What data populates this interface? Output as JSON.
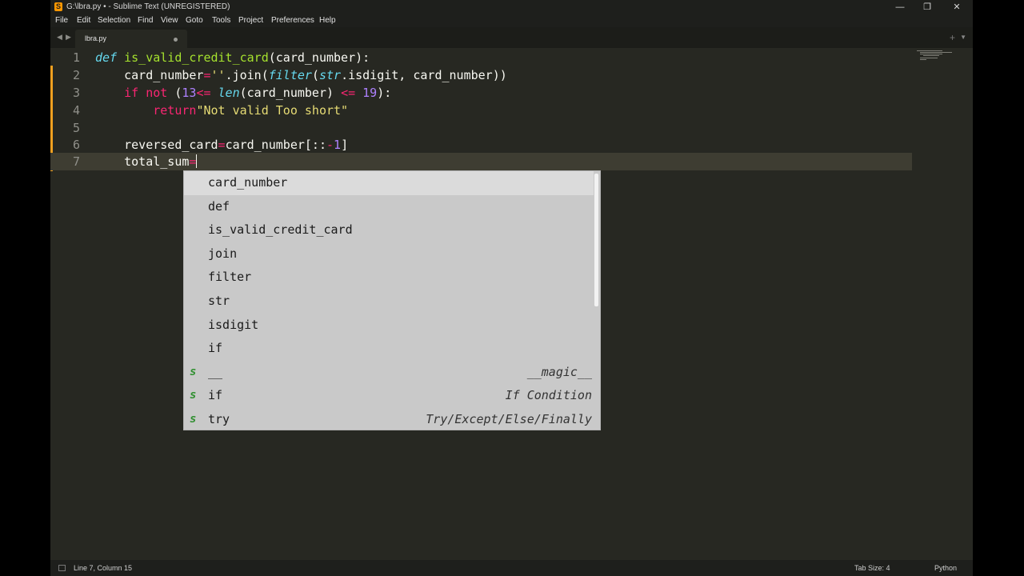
{
  "window": {
    "title": "G:\\lbra.py • - Sublime Text (UNREGISTERED)",
    "controls": [
      "—",
      "❐",
      "✕"
    ]
  },
  "menu": [
    "File",
    "Edit",
    "Selection",
    "Find",
    "View",
    "Goto",
    "Tools",
    "Project",
    "Preferences",
    "Help"
  ],
  "tabs": {
    "active": "lbra.py",
    "nav_prev": "◀",
    "nav_next": "▶",
    "new_tab": "+",
    "tab_menu": "▼"
  },
  "editor": {
    "line_numbers": [
      "1",
      "2",
      "3",
      "4",
      "5",
      "6",
      "7"
    ],
    "current_line": 7,
    "modified_lines": [
      2,
      3,
      4,
      5,
      6,
      7
    ]
  },
  "autocomplete": {
    "items": [
      {
        "label": "card_number",
        "kind": "",
        "hint": "",
        "selected": true
      },
      {
        "label": "def",
        "kind": "",
        "hint": ""
      },
      {
        "label": "is_valid_credit_card",
        "kind": "",
        "hint": ""
      },
      {
        "label": "join",
        "kind": "",
        "hint": ""
      },
      {
        "label": "filter",
        "kind": "",
        "hint": ""
      },
      {
        "label": "str",
        "kind": "",
        "hint": ""
      },
      {
        "label": "isdigit",
        "kind": "",
        "hint": ""
      },
      {
        "label": "if",
        "kind": "",
        "hint": ""
      },
      {
        "label": "__",
        "kind": "s",
        "hint": "__magic__"
      },
      {
        "label": "if",
        "kind": "s",
        "hint": "If Condition"
      },
      {
        "label": "try",
        "kind": "s",
        "hint": "Try/Except/Else/Finally"
      }
    ]
  },
  "status": {
    "position": "Line 7, Column 15",
    "tab_size": "Tab Size: 4",
    "syntax": "Python"
  },
  "colors": {
    "background": "#272822",
    "keyword": "#f92672",
    "string": "#e6db74",
    "number": "#ae81ff",
    "builtin": "#66d9ef",
    "function": "#a6e22e"
  }
}
